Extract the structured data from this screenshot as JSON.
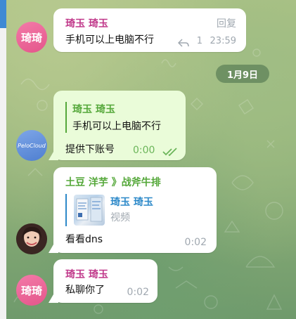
{
  "colors": {
    "accent_blue": "#2d89c9",
    "sender_pink": "#c0388a",
    "sender_green": "#55a83a",
    "outgoing_bubble": "#eafcd9",
    "incoming_bubble": "#ffffff"
  },
  "messages": [
    {
      "sender": "琦玉 琦玉",
      "avatar_text": "琦琦",
      "text": "手机可以上电脑不行",
      "reply_label": "回复",
      "reply_icon": "reply-arrow-icon",
      "reply_count": "1",
      "time": "23:59"
    },
    {
      "date_separator": "1月9日"
    },
    {
      "avatar_text": "PeloCloud",
      "quote_sender": "琦玉 琦玉",
      "quote_text": "手机可以上电脑不行",
      "text": "提供下账号",
      "time": "0:00",
      "status_icon": "double-check-icon"
    },
    {
      "sender": "土豆 洋芋 》战斧牛排",
      "quote_sender": "琦玉 琦玉",
      "quote_text": "视频",
      "text": "看看dns",
      "time": "0:02",
      "avatar_icon": "user-photo-avatar"
    },
    {
      "sender": "琦玉 琦玉",
      "avatar_text": "琦琦",
      "text": "私聊你了",
      "time": "0:02"
    }
  ]
}
